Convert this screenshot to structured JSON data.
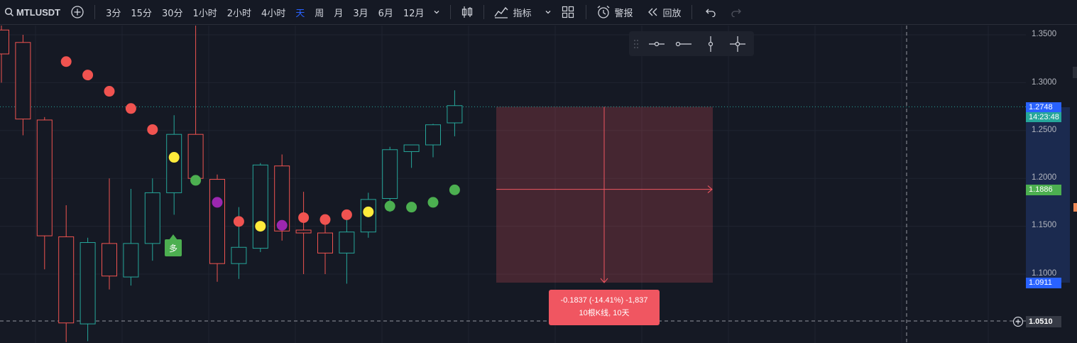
{
  "toolbar": {
    "symbol": "MTLUSDT",
    "timeframes": [
      "3分",
      "15分",
      "30分",
      "1小时",
      "2小时",
      "4小时",
      "天",
      "周",
      "月",
      "3月",
      "6月",
      "12月"
    ],
    "active_timeframe": "天",
    "indicators_label": "指标",
    "alert_label": "警报",
    "replay_label": "回放"
  },
  "price_axis": {
    "labels": [
      "1.3500",
      "1.3000",
      "1.2500",
      "1.2000",
      "1.1500",
      "1.1000"
    ],
    "last_price": "1.2748",
    "countdown": "14:23:48",
    "level_green": "1.1886",
    "level_blue": "1.0911",
    "crosshair_price": "1.0510"
  },
  "measure": {
    "line1": "-0.1837 (-14.41%) -1,837",
    "line2": "10根K线, 10天"
  },
  "badge": {
    "label": "多"
  },
  "colors": {
    "up": "#26a69a",
    "down": "#ef5350",
    "accent": "#2962ff",
    "measure": "#f05661",
    "dot_red": "#f05350",
    "dot_green": "#4caf50",
    "dot_yellow": "#ffeb3b",
    "dot_purple": "#9c27b0"
  },
  "chart_data": {
    "type": "candlestick",
    "y_range": [
      1.03,
      1.36
    ],
    "candles": [
      {
        "o": 1.33,
        "h": 1.36,
        "l": 1.3,
        "c": 1.355,
        "dir": "down"
      },
      {
        "o": 1.342,
        "h": 1.35,
        "l": 1.245,
        "c": 1.262,
        "dir": "down"
      },
      {
        "o": 1.261,
        "h": 1.264,
        "l": 1.105,
        "c": 1.14,
        "dir": "down"
      },
      {
        "o": 1.139,
        "h": 1.172,
        "l": 1.029,
        "c": 1.049,
        "dir": "down"
      },
      {
        "o": 1.048,
        "h": 1.138,
        "l": 1.03,
        "c": 1.133,
        "dir": "up"
      },
      {
        "o": 1.132,
        "h": 1.2,
        "l": 1.084,
        "c": 1.098,
        "dir": "down"
      },
      {
        "o": 1.097,
        "h": 1.189,
        "l": 1.088,
        "c": 1.132,
        "dir": "up"
      },
      {
        "o": 1.132,
        "h": 1.2,
        "l": 1.114,
        "c": 1.185,
        "dir": "up"
      },
      {
        "o": 1.185,
        "h": 1.266,
        "l": 1.162,
        "c": 1.246,
        "dir": "up"
      },
      {
        "o": 1.246,
        "h": 1.383,
        "l": 1.195,
        "c": 1.2,
        "dir": "down"
      },
      {
        "o": 1.199,
        "h": 1.204,
        "l": 1.092,
        "c": 1.111,
        "dir": "down"
      },
      {
        "o": 1.111,
        "h": 1.17,
        "l": 1.095,
        "c": 1.128,
        "dir": "up"
      },
      {
        "o": 1.127,
        "h": 1.216,
        "l": 1.123,
        "c": 1.214,
        "dir": "up"
      },
      {
        "o": 1.213,
        "h": 1.225,
        "l": 1.135,
        "c": 1.145,
        "dir": "down"
      },
      {
        "o": 1.146,
        "h": 1.186,
        "l": 1.1,
        "c": 1.143,
        "dir": "down"
      },
      {
        "o": 1.143,
        "h": 1.156,
        "l": 1.1,
        "c": 1.122,
        "dir": "down"
      },
      {
        "o": 1.122,
        "h": 1.16,
        "l": 1.09,
        "c": 1.144,
        "dir": "up"
      },
      {
        "o": 1.144,
        "h": 1.185,
        "l": 1.138,
        "c": 1.178,
        "dir": "up"
      },
      {
        "o": 1.179,
        "h": 1.233,
        "l": 1.165,
        "c": 1.23,
        "dir": "up"
      },
      {
        "o": 1.228,
        "h": 1.235,
        "l": 1.211,
        "c": 1.235,
        "dir": "up"
      },
      {
        "o": 1.235,
        "h": 1.257,
        "l": 1.222,
        "c": 1.256,
        "dir": "up"
      },
      {
        "o": 1.258,
        "h": 1.292,
        "l": 1.244,
        "c": 1.276,
        "dir": "up"
      }
    ],
    "dots": [
      {
        "i": 3,
        "y": 1.322,
        "c": "red"
      },
      {
        "i": 4,
        "y": 1.308,
        "c": "red"
      },
      {
        "i": 5,
        "y": 1.291,
        "c": "red"
      },
      {
        "i": 6,
        "y": 1.273,
        "c": "red"
      },
      {
        "i": 7,
        "y": 1.251,
        "c": "red"
      },
      {
        "i": 8,
        "y": 1.222,
        "c": "yellow"
      },
      {
        "i": 9,
        "y": 1.198,
        "c": "green"
      },
      {
        "i": 10,
        "y": 1.175,
        "c": "purple"
      },
      {
        "i": 11,
        "y": 1.155,
        "c": "red"
      },
      {
        "i": 12,
        "y": 1.15,
        "c": "yellow"
      },
      {
        "i": 13,
        "y": 1.151,
        "c": "purple"
      },
      {
        "i": 14,
        "y": 1.159,
        "c": "red"
      },
      {
        "i": 15,
        "y": 1.157,
        "c": "red"
      },
      {
        "i": 16,
        "y": 1.162,
        "c": "red"
      },
      {
        "i": 17,
        "y": 1.165,
        "c": "yellow"
      },
      {
        "i": 18,
        "y": 1.171,
        "c": "green"
      },
      {
        "i": 19,
        "y": 1.17,
        "c": "green"
      },
      {
        "i": 20,
        "y": 1.175,
        "c": "green"
      },
      {
        "i": 21,
        "y": 1.188,
        "c": "green"
      }
    ]
  }
}
